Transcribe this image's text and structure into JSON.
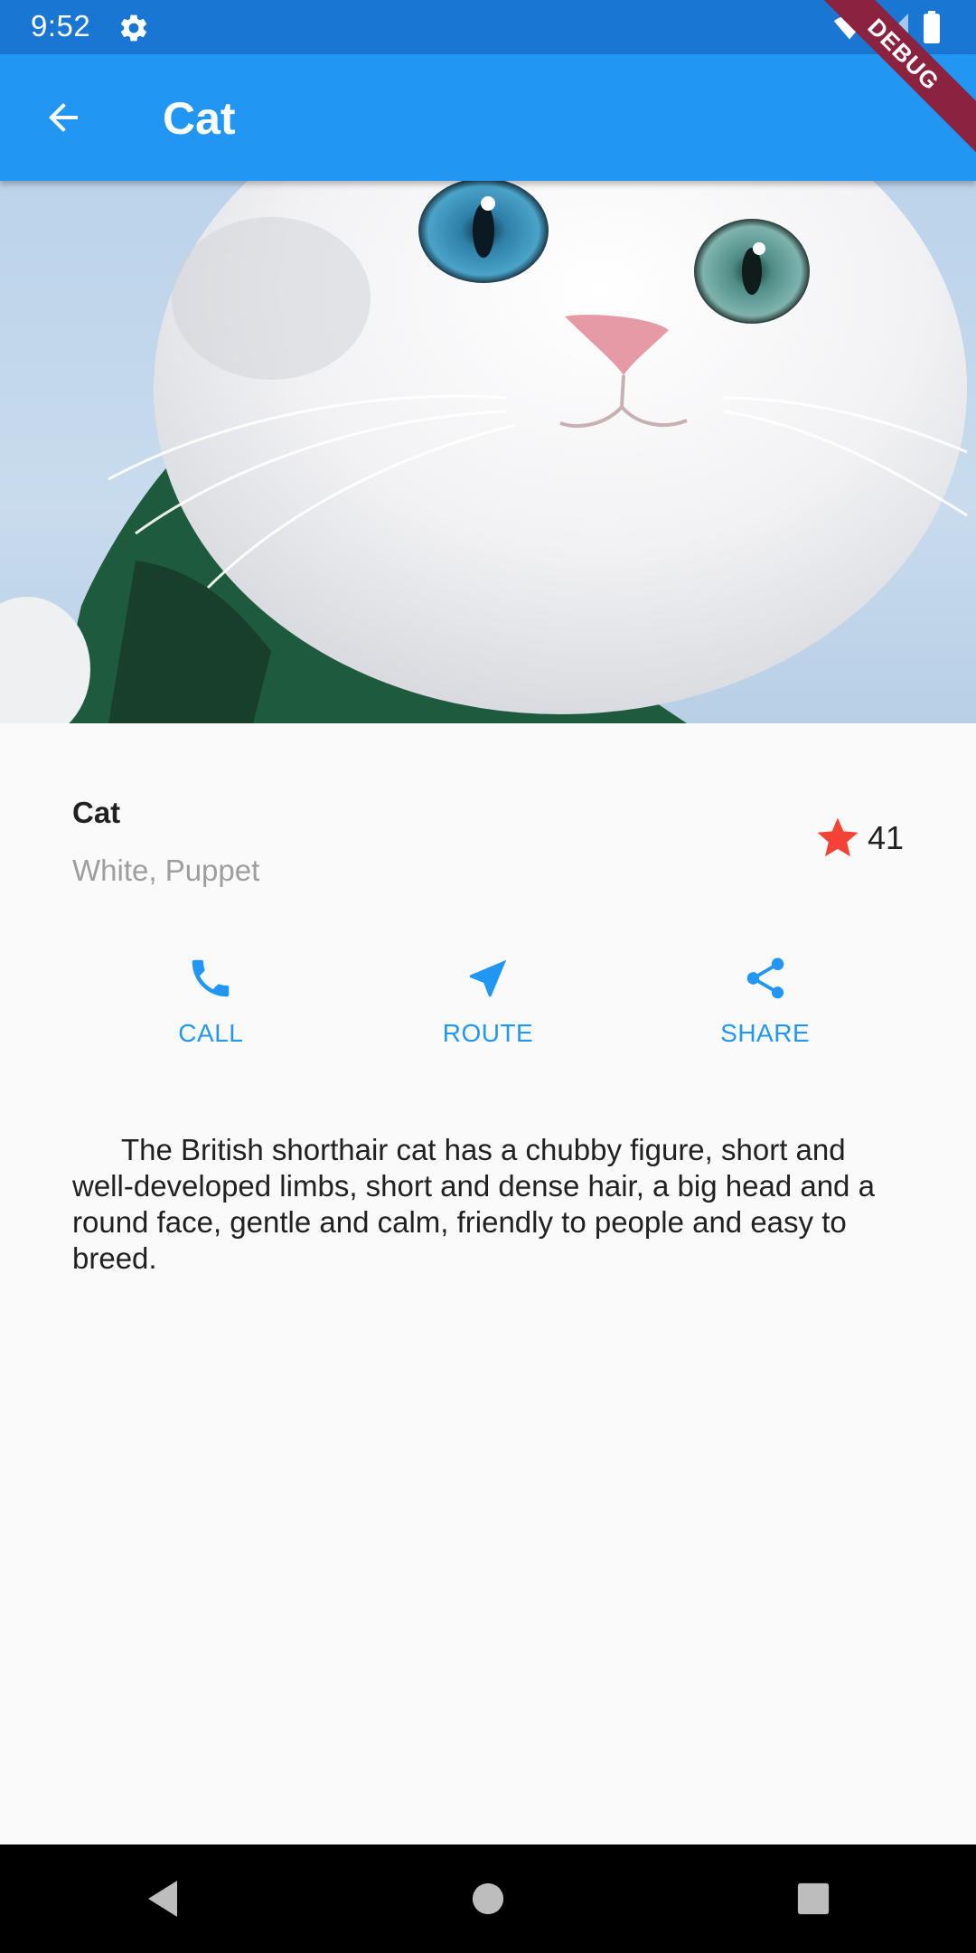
{
  "status_bar": {
    "time": "9:52",
    "icons": [
      "gear-icon",
      "wifi-icon",
      "signal-icon",
      "battery-icon"
    ]
  },
  "app_bar": {
    "title": "Cat",
    "back_icon": "arrow-back-icon",
    "color": "#2196f3"
  },
  "debug_banner": "DEBUG",
  "hero_image": {
    "subject": "white-cat-photo"
  },
  "item": {
    "name": "Cat",
    "subtitle": "White, Puppet",
    "rating": "41",
    "rating_icon": "star-icon",
    "rating_color": "#f44336"
  },
  "actions": [
    {
      "label": "CALL",
      "icon": "phone-icon"
    },
    {
      "label": "ROUTE",
      "icon": "navigation-icon"
    },
    {
      "label": "SHARE",
      "icon": "share-icon"
    }
  ],
  "description": "The British shorthair cat has a chubby figure, short and well-developed limbs, short and dense hair, a big head and a round face, gentle and calm, friendly to people and easy to breed.",
  "nav_bar": {
    "buttons": [
      "back-triangle-icon",
      "home-circle-icon",
      "recents-square-icon"
    ]
  }
}
